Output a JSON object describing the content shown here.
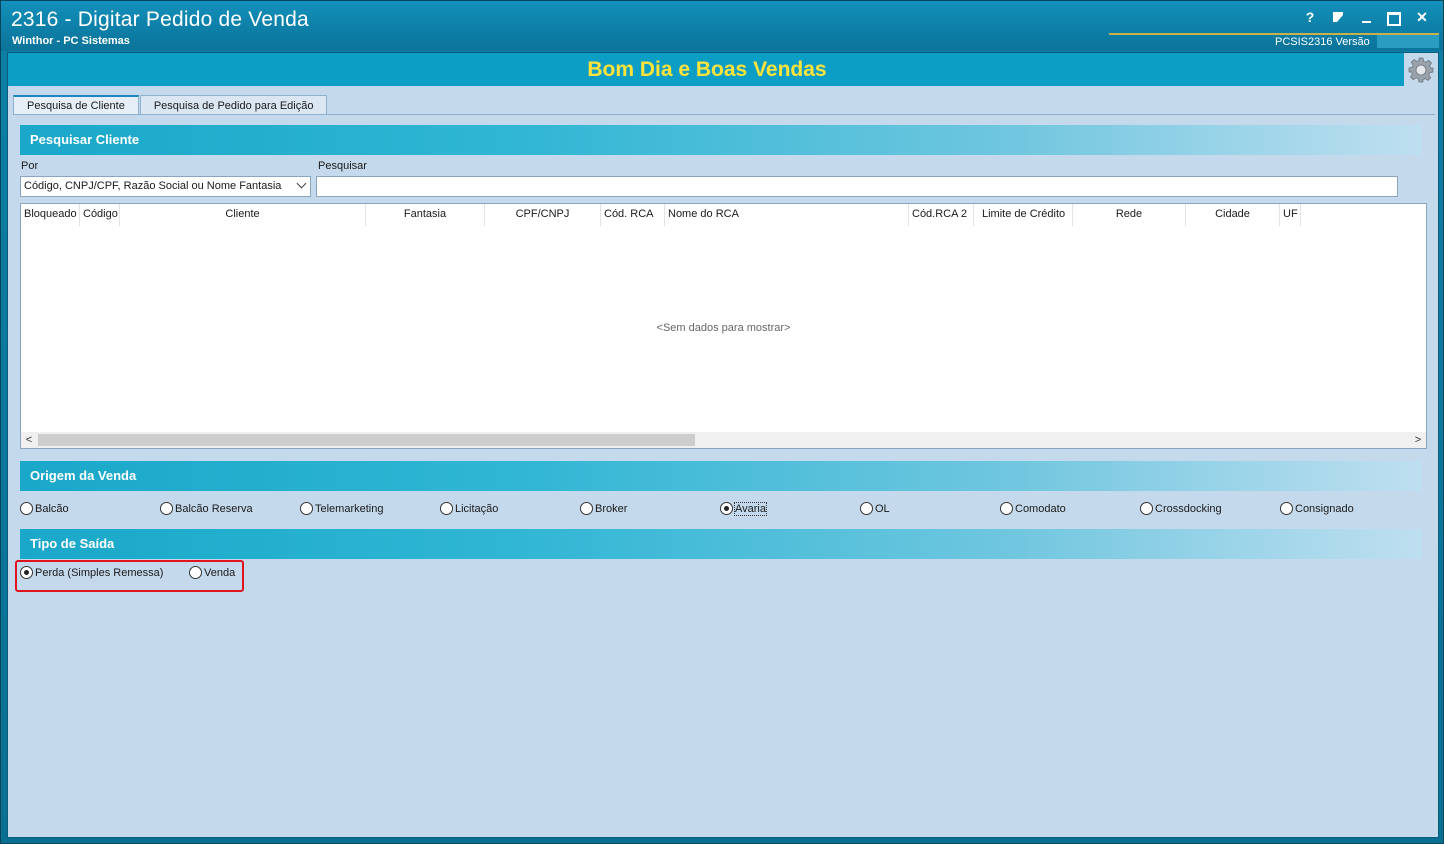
{
  "window": {
    "title": "2316 - Digitar Pedido de Venda",
    "subtitle": "Winthor - PC Sistemas",
    "version_text": "PCSIS2316  Versão",
    "controls": {
      "help": "?",
      "edit": "edit-icon",
      "minimize": "minimize-icon",
      "maximize": "maximize-icon",
      "close": "✕"
    }
  },
  "banner": {
    "text": "Bom Dia e Boas Vendas",
    "icon": "gear-icon"
  },
  "tabs": [
    {
      "label": "Pesquisa de Cliente",
      "active": true
    },
    {
      "label": "Pesquisa de Pedido para Edição",
      "active": false
    }
  ],
  "pesquisar_cliente": {
    "title": "Pesquisar Cliente",
    "por_label": "Por",
    "por_value": "Código, CNPJ/CPF, Razão Social ou Nome Fantasia",
    "pesquisar_label": "Pesquisar",
    "pesquisar_value": ""
  },
  "grid": {
    "columns": [
      "Bloqueado",
      "Código",
      "Cliente",
      "Fantasia",
      "CPF/CNPJ",
      "Cód. RCA",
      "Nome do RCA",
      "Cód.RCA 2",
      "Limite de Crédito",
      "Rede",
      "Cidade",
      "UF"
    ],
    "empty_message": "<Sem dados para mostrar>",
    "scroll_left": "<",
    "scroll_right": ">"
  },
  "origem_venda": {
    "title": "Origem da Venda",
    "options": [
      "Balcão",
      "Balcão Reserva",
      "Telemarketing",
      "Licitação",
      "Broker",
      "Avaria",
      "OL",
      "Comodato",
      "Crossdocking",
      "Consignado"
    ],
    "selected": "Avaria"
  },
  "tipo_saida": {
    "title": "Tipo de Saída",
    "options": [
      "Perda (Simples Remessa)",
      "Venda"
    ],
    "selected": "Perda (Simples Remessa)"
  },
  "colors": {
    "titlebar": "#0d7ea6",
    "banner": "#0c9ec4",
    "banner_text": "#ffe33a",
    "content_bg": "#c5d9ec",
    "highlight": "#e0141e"
  }
}
